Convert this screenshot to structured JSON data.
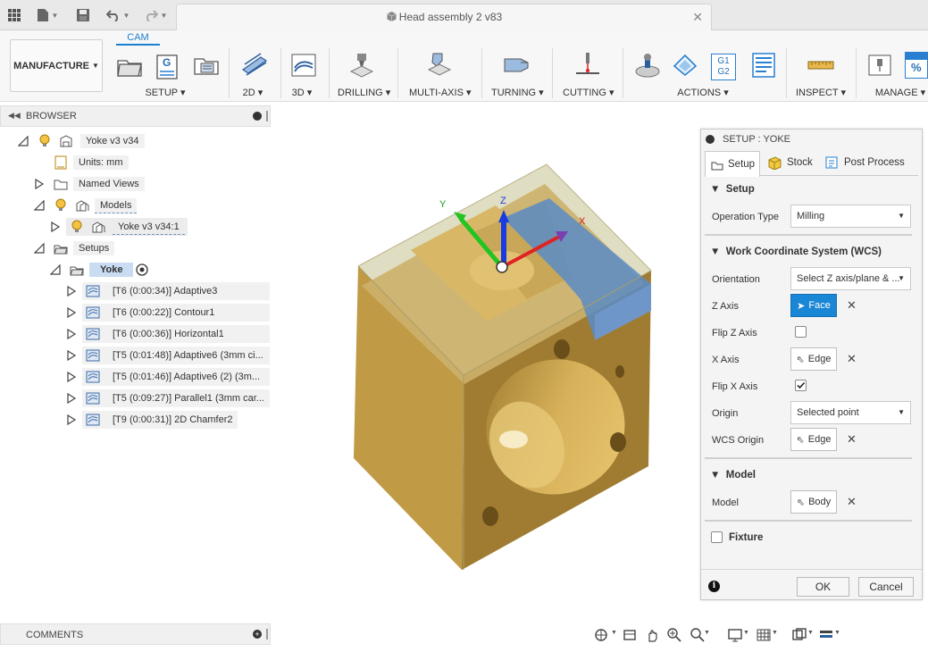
{
  "titlebar": {
    "doc_title": "Head assembly 2 v83",
    "close": "✕"
  },
  "ribbon": {
    "workspace_label": "MANUFACTURE",
    "tab_cam": "CAM",
    "groups": {
      "setup": "SETUP",
      "g2d": "2D",
      "g3d": "3D",
      "drilling": "DRILLING",
      "multiaxis": "MULTI-AXIS",
      "turning": "TURNING",
      "cutting": "CUTTING",
      "actions": "ACTIONS",
      "inspect": "INSPECT",
      "manage": "MANAGE"
    },
    "g1g2_a": "G1",
    "g1g2_b": "G2",
    "pct": "%",
    "g_letter": "G"
  },
  "browser": {
    "title": "BROWSER",
    "root": "Yoke v3 v34",
    "units": "Units: mm",
    "named_views": "Named Views",
    "models": "Models",
    "model_item": "Yoke v3 v34:1",
    "setups": "Setups",
    "setup_name": "Yoke",
    "operations": [
      "[T6 (0:00:34)] Adaptive3",
      "[T6 (0:00:22)] Contour1",
      "[T6 (0:00:36)] Horizontal1",
      "[T5 (0:01:48)] Adaptive6 (3mm ci...",
      "[T5 (0:01:46)] Adaptive6 (2) (3m...",
      "[T5 (0:09:27)] Parallel1 (3mm car...",
      "[T9 (0:00:31)] 2D Chamfer2"
    ]
  },
  "viewport": {
    "axis_x": "X",
    "axis_y": "Y",
    "axis_z": "Z"
  },
  "setup_panel": {
    "title": "SETUP : YOKE",
    "tabs": [
      "Setup",
      "Stock",
      "Post Process"
    ],
    "section_setup": "Setup",
    "operation_type_label": "Operation Type",
    "operation_type_value": "Milling",
    "section_wcs": "Work Coordinate System (WCS)",
    "orientation_label": "Orientation",
    "orientation_value": "Select Z axis/plane & ...",
    "z_axis_label": "Z Axis",
    "z_axis_value": "Face",
    "flip_z_label": "Flip Z Axis",
    "flip_z_checked": false,
    "x_axis_label": "X Axis",
    "x_axis_value": "Edge",
    "flip_x_label": "Flip X Axis",
    "flip_x_checked": true,
    "origin_label": "Origin",
    "origin_value": "Selected point",
    "wcs_origin_label": "WCS Origin",
    "wcs_origin_value": "Edge",
    "section_model": "Model",
    "model_label": "Model",
    "model_value": "Body",
    "fixture_label": "Fixture",
    "ok": "OK",
    "cancel": "Cancel",
    "remove": "✕"
  },
  "comments": {
    "title": "COMMENTS"
  }
}
